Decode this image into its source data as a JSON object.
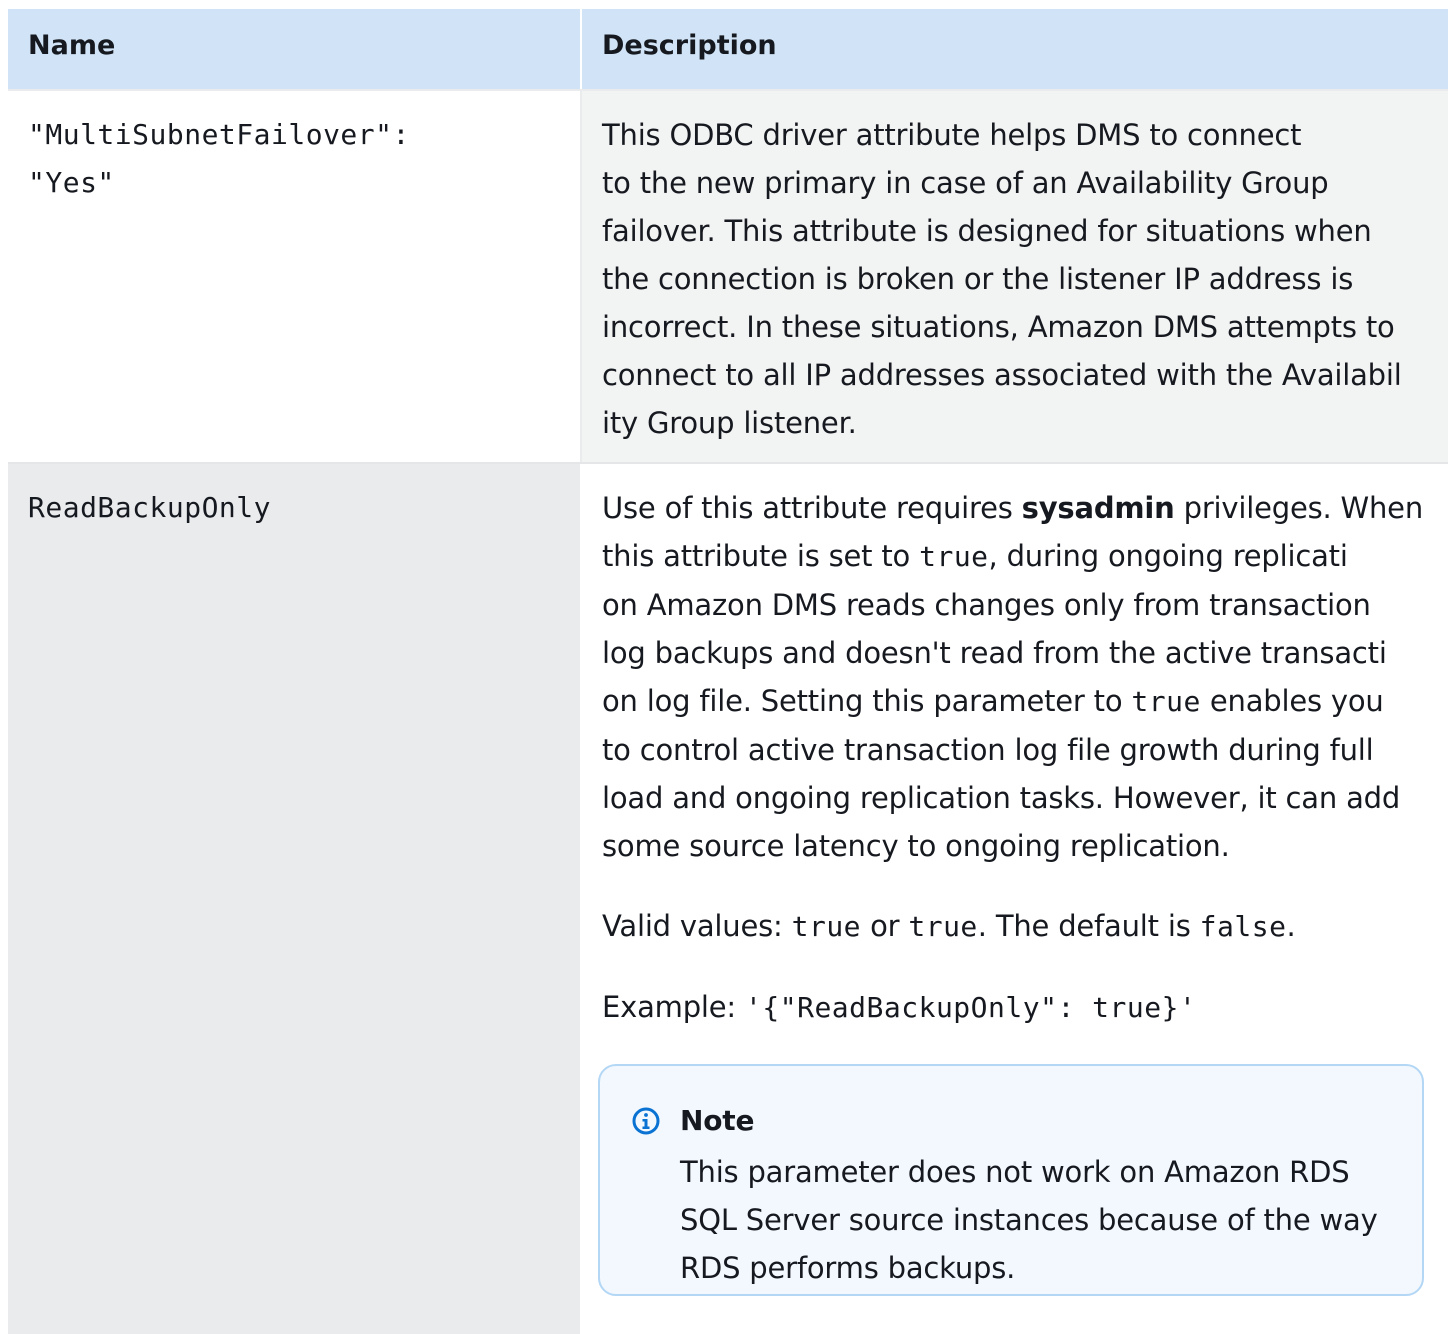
{
  "header": {
    "name": "Name",
    "description": "Description"
  },
  "rows": [
    {
      "name_line1": "\"MultiSubnetFailover\":",
      "name_line2": "\"Yes\"",
      "description_lines": [
        "This ODBC driver attribute helps DMS to connect",
        "to the new primary in case of an Availability Group",
        "failover. This attribute is designed for situations when",
        "the connection is broken or the listener IP address is",
        "incorrect. In these situations, Amazon DMS attempts to",
        "connect to all IP addresses associated with the Availabil",
        "ity Group listener."
      ]
    },
    {
      "name": "ReadBackupOnly",
      "p1": {
        "l1_before": "Use of this attribute requires ",
        "l1_bold": "sysadmin",
        "l1_after": " privileges. When",
        "l2_before": "this attribute is set to ",
        "l2_code": "true",
        "l2_after": ", during ongoing replicati",
        "l3": "on Amazon DMS reads changes only from transaction",
        "l4": "log backups and doesn't read from the active transacti",
        "l5_before": "on log file. Setting this parameter to ",
        "l5_code": "true",
        "l5_after": " enables you",
        "l6": "to control active transaction log file growth during full",
        "l7": "load and ongoing replication tasks. However, it can add",
        "l8": "some source latency to ongoing replication."
      },
      "p2": {
        "before": "Valid values: ",
        "code1": "true",
        "mid": " or ",
        "code2": "true",
        "after": ". The default is ",
        "code3": "false",
        "end": "."
      },
      "p3": {
        "before": "Example: ",
        "code": "'{\"ReadBackupOnly\": true}'"
      },
      "note": {
        "title": "Note",
        "lines": [
          "This parameter does not work on Amazon RDS",
          "SQL Server source instances because of the way",
          "RDS performs backups."
        ]
      }
    }
  ],
  "colors": {
    "header_bg": "#d1e4f7",
    "alt_row_bg": "#e9ebed",
    "note_border": "#b3d7f5",
    "note_bg": "#f2f8fd",
    "info_icon": "#0972d3"
  }
}
